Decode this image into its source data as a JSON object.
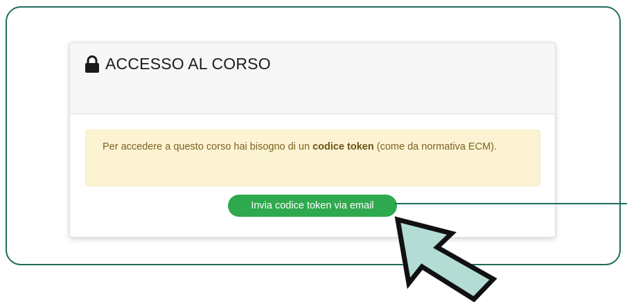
{
  "card": {
    "title": "ACCESSO AL CORSO",
    "alert": {
      "text_before": "Per accedere a questo corso hai bisogno di un ",
      "bold": "codice token",
      "text_after": " (come da normativa ECM)."
    },
    "button_label": "Invia codice token via email"
  },
  "icons": {
    "title_icon": "lock-icon",
    "pointer": "cursor-arrow-icon"
  },
  "colors": {
    "frame_border": "#1f6b5c",
    "button_bg": "#2ea94d",
    "alert_bg": "#fcf3d3",
    "alert_text": "#7b6320",
    "cursor_fill": "#b3dcd4"
  }
}
